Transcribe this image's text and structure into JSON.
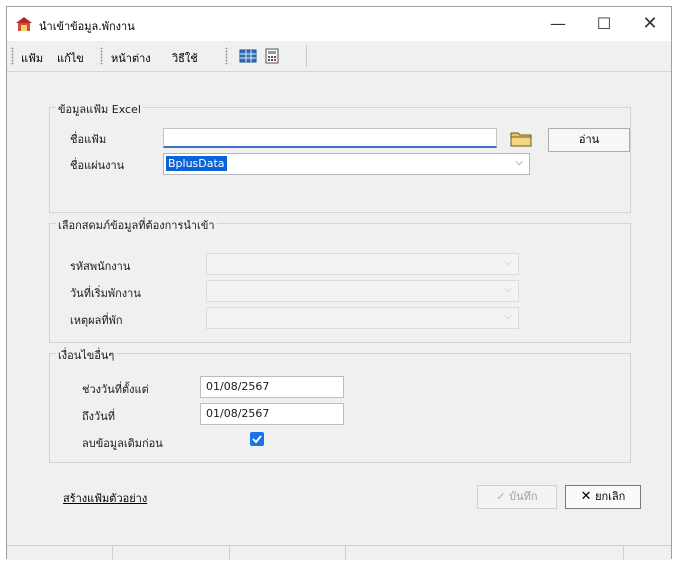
{
  "window": {
    "title": "นำเข้าข้อมูล.พักงาน",
    "minimize_glyph": "—",
    "maximize_glyph": "☐",
    "close_glyph": "✕"
  },
  "menu": {
    "items": [
      "แฟ้ม",
      "แก้ไข",
      "หน้าต่าง",
      "วิธีใช้"
    ]
  },
  "toolbar": {
    "icons": [
      "grid-icon",
      "calculator-icon"
    ]
  },
  "excel_group": {
    "title": "ข้อมูลแฟ้ม Excel",
    "file_label": "ชื่อแฟ้ม",
    "file_value": "",
    "read_button": "อ่าน",
    "sheet_label": "ชื่อแผ่นงาน",
    "sheet_value": "BplusData"
  },
  "columns_group": {
    "title": "เลือกสดมภ์ข้อมูลที่ต้องการนำเข้า",
    "fields": [
      "รหัสพนักงาน",
      "วันที่เริ่มพักงาน",
      "เหตุผลที่พัก"
    ]
  },
  "conditions_group": {
    "title": "เงื่อนไขอื่นๆ",
    "from_label": "ช่วงวันที่ตั้งแต่",
    "from_value": "01/08/2567",
    "to_label": "ถึงวันที่",
    "to_value": "01/08/2567",
    "delete_label": "ลบข้อมูลเดิมก่อน",
    "delete_checked": true
  },
  "footer": {
    "sample_link": "สร้างแฟ้มตัวอย่าง",
    "save_label": "บันทึก",
    "cancel_label": "ยกเลิก"
  },
  "colors": {
    "accent": "#0a64d8",
    "checkbox": "#1a73e8"
  }
}
